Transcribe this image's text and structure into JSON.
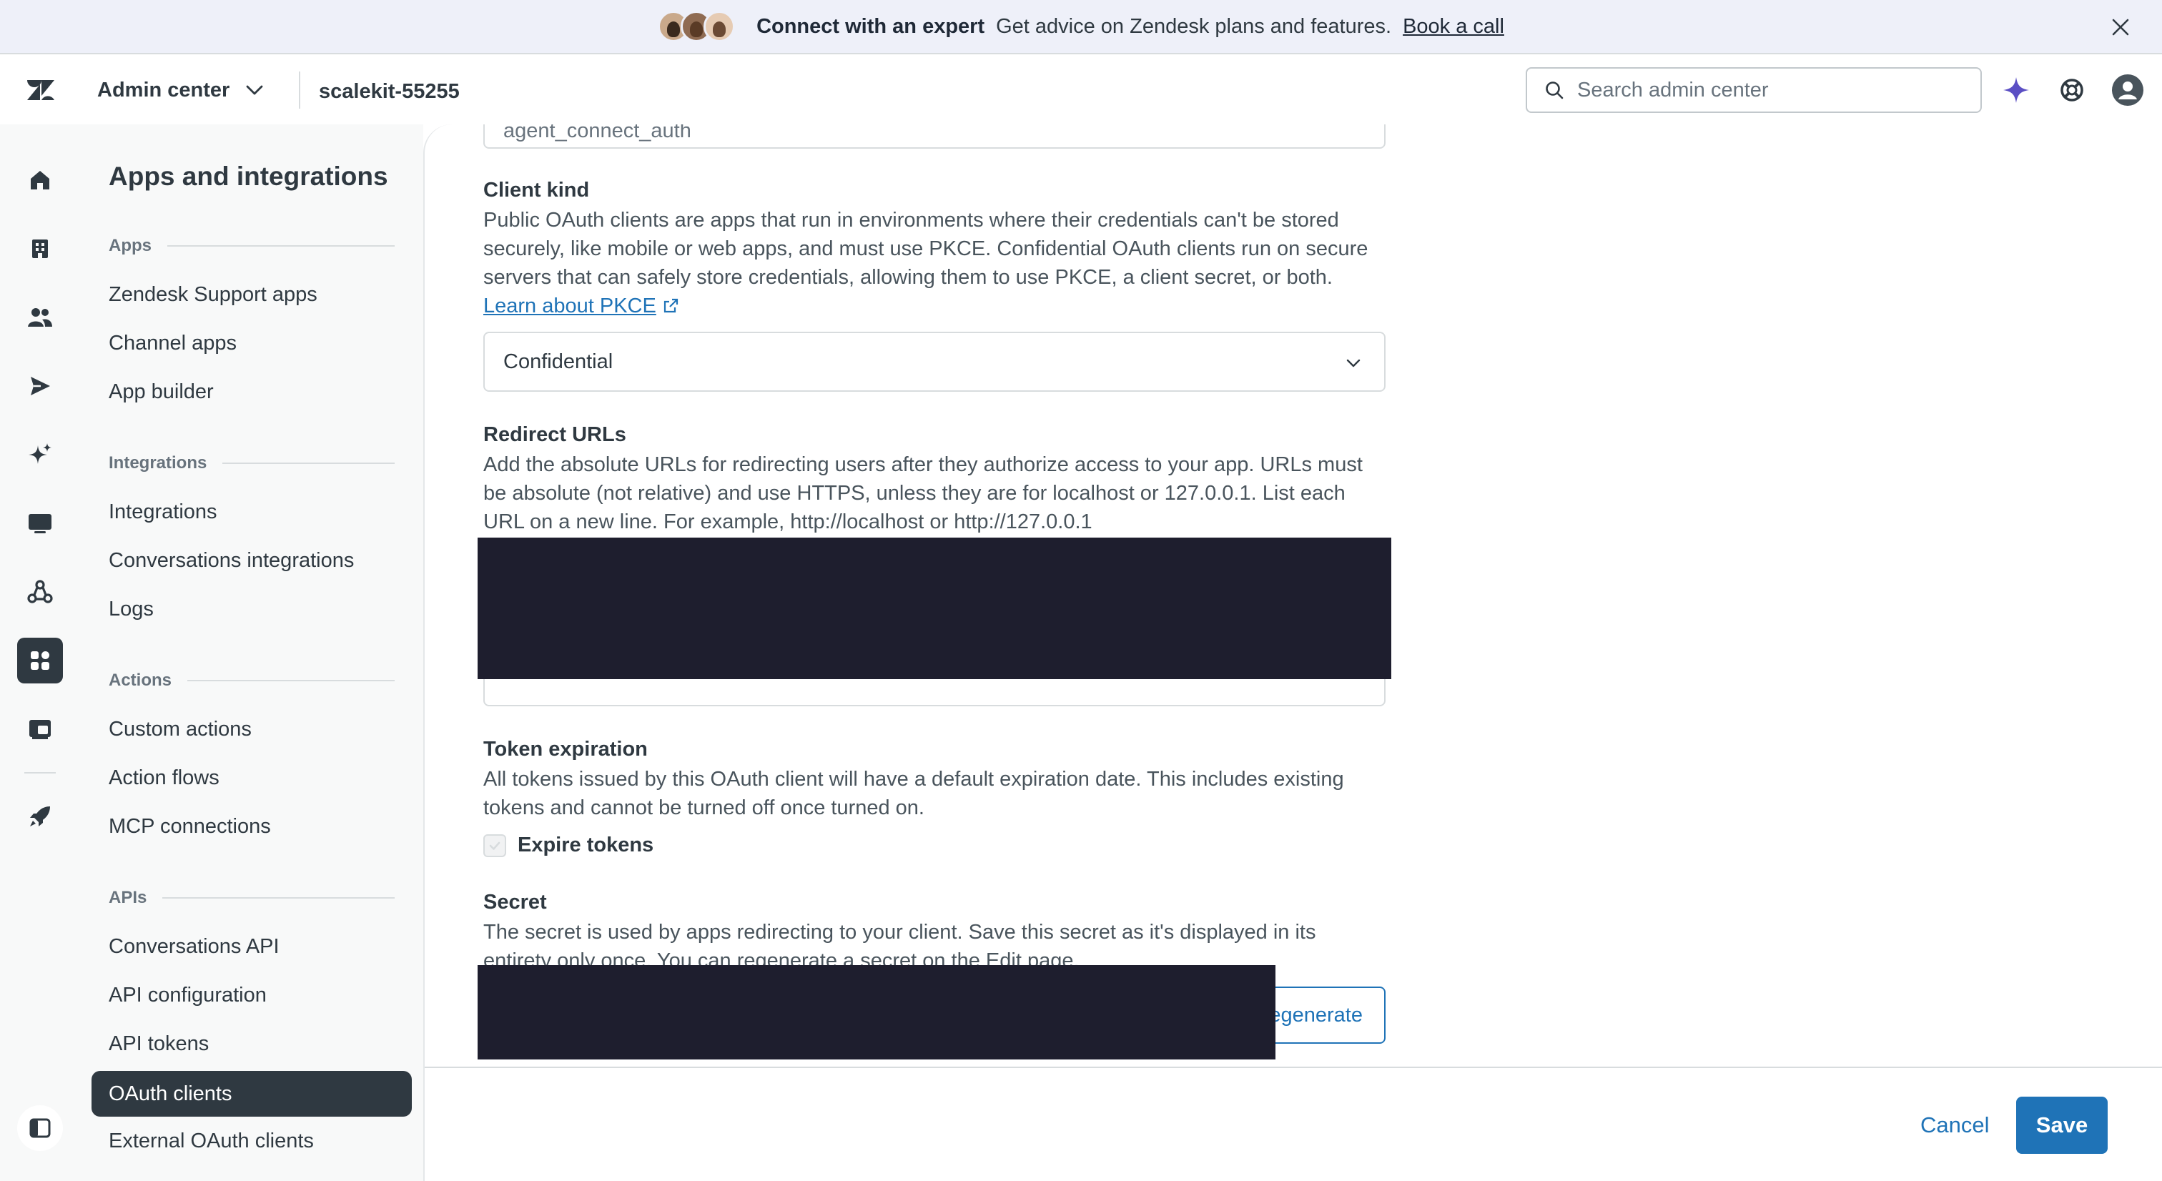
{
  "banner": {
    "title": "Connect with an expert",
    "text": "Get advice on Zendesk plans and features.",
    "link": "Book a call"
  },
  "header": {
    "product": "Admin center",
    "account": "scalekit-55255",
    "search_placeholder": "Search admin center"
  },
  "rail": {
    "icons": [
      "home-icon",
      "building-icon",
      "people-icon",
      "send-icon",
      "sparkle-icon",
      "monitor-icon",
      "recycle-icon",
      "apps-icon",
      "workspace-icon",
      "rocket-icon"
    ],
    "active": "apps-icon"
  },
  "subnav": {
    "title": "Apps and integrations",
    "groups": {
      "apps": {
        "label": "Apps",
        "items": [
          "Zendesk Support apps",
          "Channel apps",
          "App builder"
        ]
      },
      "integrations": {
        "label": "Integrations",
        "items": [
          "Integrations",
          "Conversations integrations",
          "Logs"
        ]
      },
      "actions": {
        "label": "Actions",
        "items": [
          "Custom actions",
          "Action flows",
          "MCP connections"
        ]
      },
      "apis": {
        "label": "APIs",
        "items": [
          "Conversations API",
          "API configuration",
          "API tokens",
          "OAuth clients",
          "External OAuth clients"
        ]
      }
    },
    "active_item": "OAuth clients"
  },
  "form": {
    "identifier_value": "agent_connect_auth",
    "client_kind": {
      "label": "Client kind",
      "hint": "Public OAuth clients are apps that run in environments where their credentials can't be stored securely, like mobile or web apps, and must use PKCE. Confidential OAuth clients run on secure servers that can safely store credentials, allowing them to use PKCE, a client secret, or both.",
      "link": "Learn about PKCE",
      "selected": "Confidential"
    },
    "redirect_urls": {
      "label": "Redirect URLs",
      "hint": "Add the absolute URLs for redirecting users after they authorize access to your app. URLs must be absolute (not relative) and use HTTPS, unless they are for localhost or 127.0.0.1. List each URL on a new line. For example, http://localhost or http://127.0.0.1"
    },
    "token_expiration": {
      "label": "Token expiration",
      "hint": "All tokens issued by this OAuth client will have a default expiration date. This includes existing tokens and cannot be turned off once turned on.",
      "checkbox_label": "Expire tokens"
    },
    "secret": {
      "label": "Secret",
      "hint": "The secret is used by apps redirecting to your client. Save this secret as it's displayed in its entirety only once. You can regenerate a secret on the Edit page.",
      "regenerate_label": "Regenerate"
    }
  },
  "footer": {
    "cancel": "Cancel",
    "save": "Save"
  },
  "colors": {
    "primary": "#1f73b7",
    "dark": "#2f3941",
    "redaction": "#1e1e2e"
  }
}
